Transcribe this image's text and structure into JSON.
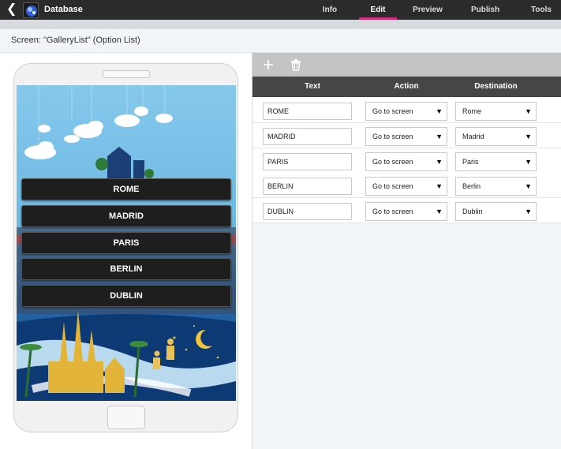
{
  "app": {
    "title": "Database"
  },
  "nav": [
    {
      "label": "Info",
      "active": false
    },
    {
      "label": "Edit",
      "active": true
    },
    {
      "label": "Preview",
      "active": false
    },
    {
      "label": "Publish",
      "active": false
    },
    {
      "label": "Tools",
      "active": false
    }
  ],
  "screen": {
    "title": "Screen: \"GalleryList\" (Option List)"
  },
  "preview": {
    "options": [
      "ROME",
      "MADRID",
      "PARIS",
      "BERLIN",
      "DUBLIN"
    ]
  },
  "toolbar": {
    "add_icon": "plus-icon",
    "delete_icon": "trash-icon"
  },
  "table": {
    "headers": {
      "text": "Text",
      "action": "Action",
      "destination": "Destination"
    },
    "rows": [
      {
        "text": "ROME",
        "action": "Go to screen",
        "destination": "Rome"
      },
      {
        "text": "MADRID",
        "action": "Go to screen",
        "destination": "Madrid"
      },
      {
        "text": "PARIS",
        "action": "Go to screen",
        "destination": "Paris"
      },
      {
        "text": "BERLIN",
        "action": "Go to screen",
        "destination": "Berlin"
      },
      {
        "text": "DUBLIN",
        "action": "Go to screen",
        "destination": "Dublin"
      }
    ]
  },
  "colors": {
    "accent": "#d6287e",
    "topbar": "#2b2b2b",
    "table_header": "#464646"
  }
}
